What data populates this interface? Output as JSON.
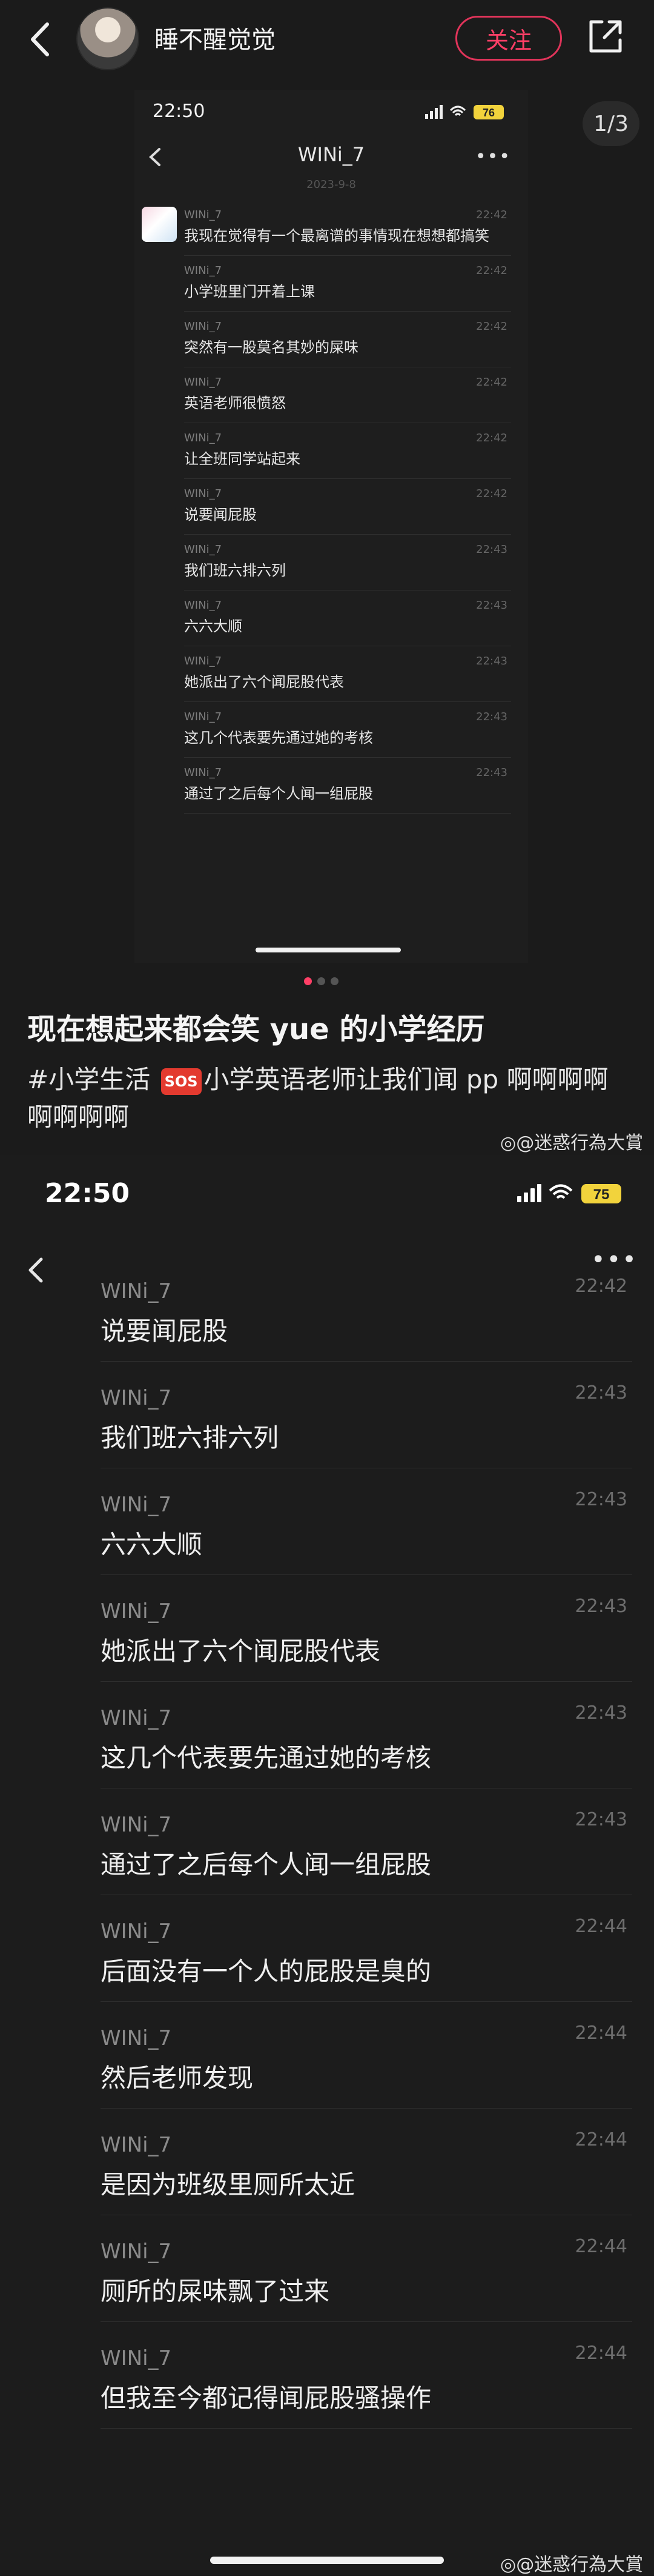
{
  "post": {
    "username": "睡不醒觉觉",
    "follow_label": "关注",
    "image_counter": "1/3",
    "title": "现在想起来都会笑 yue 的小学经历",
    "hashtag": "#小学生活",
    "sos": "SOS",
    "desc_rest": "小学英语老师让我们闻 pp 啊啊啊啊啊啊啊啊",
    "watermark": "@迷惑行為大賞"
  },
  "inner_screenshot": {
    "time": "22:50",
    "battery": "76",
    "title": "WINi_7",
    "date": "2023-9-8",
    "messages": [
      {
        "name": "WINi_7",
        "time": "22:42",
        "text": "我现在觉得有一个最离谱的事情现在想想都搞笑"
      },
      {
        "name": "WINi_7",
        "time": "22:42",
        "text": "小学班里门开着上课"
      },
      {
        "name": "WINi_7",
        "time": "22:42",
        "text": "突然有一股莫名其妙的屎味"
      },
      {
        "name": "WINi_7",
        "time": "22:42",
        "text": "英语老师很愤怒"
      },
      {
        "name": "WINi_7",
        "time": "22:42",
        "text": "让全班同学站起来"
      },
      {
        "name": "WINi_7",
        "time": "22:42",
        "text": "说要闻屁股"
      },
      {
        "name": "WINi_7",
        "time": "22:43",
        "text": "我们班六排六列"
      },
      {
        "name": "WINi_7",
        "time": "22:43",
        "text": "六六大顺"
      },
      {
        "name": "WINi_7",
        "time": "22:43",
        "text": "她派出了六个闻屁股代表"
      },
      {
        "name": "WINi_7",
        "time": "22:43",
        "text": "这几个代表要先通过她的考核"
      },
      {
        "name": "WINi_7",
        "time": "22:43",
        "text": "通过了之后每个人闻一组屁股"
      }
    ]
  },
  "chat": {
    "time": "22:50",
    "battery": "75",
    "messages": [
      {
        "name": "WINi_7",
        "time": "22:42",
        "text": "说要闻屁股"
      },
      {
        "name": "WINi_7",
        "time": "22:43",
        "text": "我们班六排六列"
      },
      {
        "name": "WINi_7",
        "time": "22:43",
        "text": "六六大顺"
      },
      {
        "name": "WINi_7",
        "time": "22:43",
        "text": "她派出了六个闻屁股代表"
      },
      {
        "name": "WINi_7",
        "time": "22:43",
        "text": "这几个代表要先通过她的考核"
      },
      {
        "name": "WINi_7",
        "time": "22:43",
        "text": "通过了之后每个人闻一组屁股"
      },
      {
        "name": "WINi_7",
        "time": "22:44",
        "text": "后面没有一个人的屁股是臭的"
      },
      {
        "name": "WINi_7",
        "time": "22:44",
        "text": "然后老师发现"
      },
      {
        "name": "WINi_7",
        "time": "22:44",
        "text": "是因为班级里厕所太近"
      },
      {
        "name": "WINi_7",
        "time": "22:44",
        "text": "厕所的屎味飘了过来"
      },
      {
        "name": "WINi_7",
        "time": "22:44",
        "text": "但我至今都记得闻屁股骚操作"
      }
    ],
    "watermark": "@迷惑行為大賞"
  },
  "colors": {
    "accent": "#ff3f66",
    "battery": "#f2d33c",
    "background": "#181818"
  },
  "icons": {
    "back": "chevron-left-icon",
    "share": "share-icon",
    "more": "more-dots-icon",
    "weibo": "weibo-logo-icon"
  }
}
